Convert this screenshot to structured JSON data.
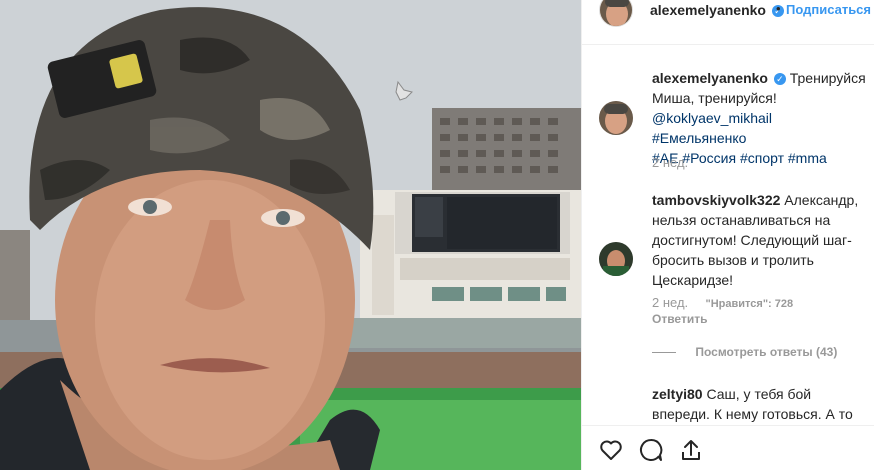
{
  "post": {
    "author": "alexemelyanenko",
    "follow_label": "Подписаться",
    "separator": "•",
    "verified_mark": "✓",
    "caption": {
      "author": "alexemelyanenko",
      "line1": "Тренируйся",
      "line2": "Миша, тренируйся!",
      "mention": "@koklyaev_mikhail",
      "tag1": "#Емельяненко",
      "tag2": "#AE",
      "tag3": "#Россия",
      "tag4": "#спорт",
      "tag5": "#mma",
      "time": "2 нед."
    },
    "comments": [
      {
        "author": "tambovskiyvolk322",
        "line1": "Александр,",
        "line2": "нельзя останавливаться на",
        "line3": "достигнутом! Следующий шаг-",
        "line4": "бросить вызов и тролить",
        "line5": "Цескаридзе!",
        "time": "2 нед.",
        "likes": "\"Нравится\": 728",
        "reply_label": "Ответить",
        "view_replies": "Посмотреть ответы (43)"
      },
      {
        "author": "zeltyi80",
        "line1": "Саш, у тебя бой",
        "line2": "впереди. К нему готовься. А то"
      }
    ]
  },
  "icons": {
    "like": "heart-icon",
    "comment": "comment-bubble-icon",
    "share": "share-arrow-icon",
    "verified": "verified-badge-icon"
  },
  "colors": {
    "link_blue": "#3897f0",
    "hashtag": "#003569",
    "muted": "#999999",
    "text": "#262626"
  }
}
